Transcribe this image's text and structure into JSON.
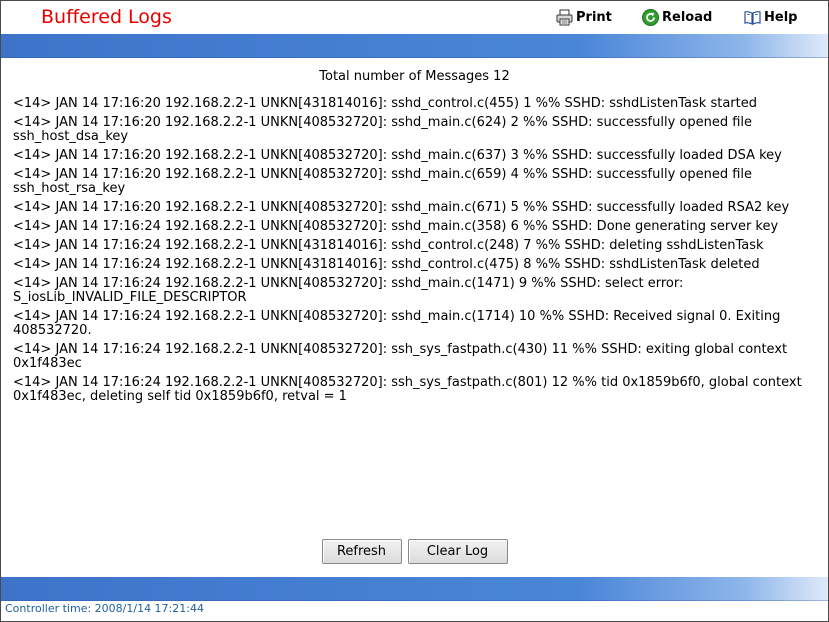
{
  "header": {
    "title": "Buffered Logs",
    "print_label": "Print",
    "reload_label": "Reload",
    "help_label": "Help"
  },
  "main": {
    "total_messages": "Total number of Messages 12",
    "logs": [
      "<14> JAN 14 17:16:20 192.168.2.2-1 UNKN[431814016]: sshd_control.c(455) 1 %% SSHD: sshdListenTask started",
      "<14> JAN 14 17:16:20 192.168.2.2-1 UNKN[408532720]: sshd_main.c(624) 2 %% SSHD: successfully opened file ssh_host_dsa_key",
      "<14> JAN 14 17:16:20 192.168.2.2-1 UNKN[408532720]: sshd_main.c(637) 3 %% SSHD: successfully loaded DSA key",
      "<14> JAN 14 17:16:20 192.168.2.2-1 UNKN[408532720]: sshd_main.c(659) 4 %% SSHD: successfully opened file ssh_host_rsa_key",
      "<14> JAN 14 17:16:20 192.168.2.2-1 UNKN[408532720]: sshd_main.c(671) 5 %% SSHD: successfully loaded RSA2 key",
      "<14> JAN 14 17:16:24 192.168.2.2-1 UNKN[408532720]: sshd_main.c(358) 6 %% SSHD: Done generating server key",
      "<14> JAN 14 17:16:24 192.168.2.2-1 UNKN[431814016]: sshd_control.c(248) 7 %% SSHD: deleting sshdListenTask",
      "<14> JAN 14 17:16:24 192.168.2.2-1 UNKN[431814016]: sshd_control.c(475) 8 %% SSHD: sshdListenTask deleted",
      "<14> JAN 14 17:16:24 192.168.2.2-1 UNKN[408532720]: sshd_main.c(1471) 9 %% SSHD: select error: S_iosLib_INVALID_FILE_DESCRIPTOR",
      "<14> JAN 14 17:16:24 192.168.2.2-1 UNKN[408532720]: sshd_main.c(1714) 10 %% SSHD: Received signal 0. Exiting 408532720.",
      "<14> JAN 14 17:16:24 192.168.2.2-1 UNKN[408532720]: ssh_sys_fastpath.c(430) 11 %% SSHD: exiting global context 0x1f483ec",
      "<14> JAN 14 17:16:24 192.168.2.2-1 UNKN[408532720]: ssh_sys_fastpath.c(801) 12 %% tid 0x1859b6f0, global context 0x1f483ec, deleting self tid 0x1859b6f0, retval = 1"
    ],
    "refresh_label": "Refresh",
    "clear_log_label": "Clear Log"
  },
  "footer": {
    "controller_time": "Controller time: 2008/1/14 17:21:44"
  },
  "icons": {
    "print": "printer-icon",
    "reload": "reload-icon",
    "help": "help-book-icon"
  },
  "colors": {
    "title": "#e60000",
    "band": "#4a86d8",
    "footer_text": "#2060a0"
  }
}
